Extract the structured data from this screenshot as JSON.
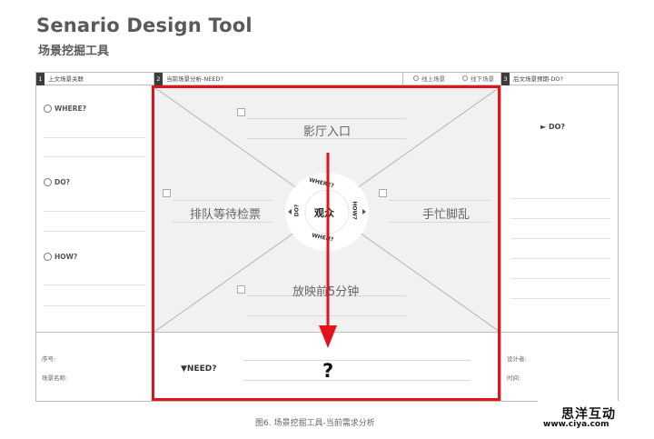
{
  "header": {
    "title": "Senario Design Tool",
    "subtitle": "场景挖掘工具"
  },
  "columns": {
    "col1": {
      "num": "1",
      "label": "上文场景关联"
    },
    "col2": {
      "num": "2",
      "label": "当前场景分析-NEED?"
    },
    "opt_online": "线上场景",
    "opt_offline": "线下场景",
    "col3": {
      "num": "3",
      "label": "后文场景预期-DO?"
    }
  },
  "left": {
    "where": "WHERE?",
    "do": "DO?",
    "how": "HOW?",
    "seq": "序号:",
    "scene_name": "场景名称:"
  },
  "center": {
    "top": "影厅入口",
    "left": "排队等待检票",
    "right": "手忙脚乱",
    "bottom": "放映前5分钟",
    "hub": "观众",
    "hub_where": "WHERE?",
    "hub_how": "HOW?",
    "hub_when": "WHEN?",
    "hub_do": "DO?",
    "need": "▼NEED?",
    "question": "?"
  },
  "right": {
    "do": "► DO?",
    "designer": "设计者:",
    "time": "时间:"
  },
  "caption": "图6. 场景挖掘工具-当前需求分析",
  "watermark": {
    "cn": "思洋互动",
    "url": "www.ciya.com"
  },
  "colors": {
    "accent_red": "#e3131b",
    "panel_gray": "#f1f1f1",
    "header_num": "#3d3d3d"
  }
}
